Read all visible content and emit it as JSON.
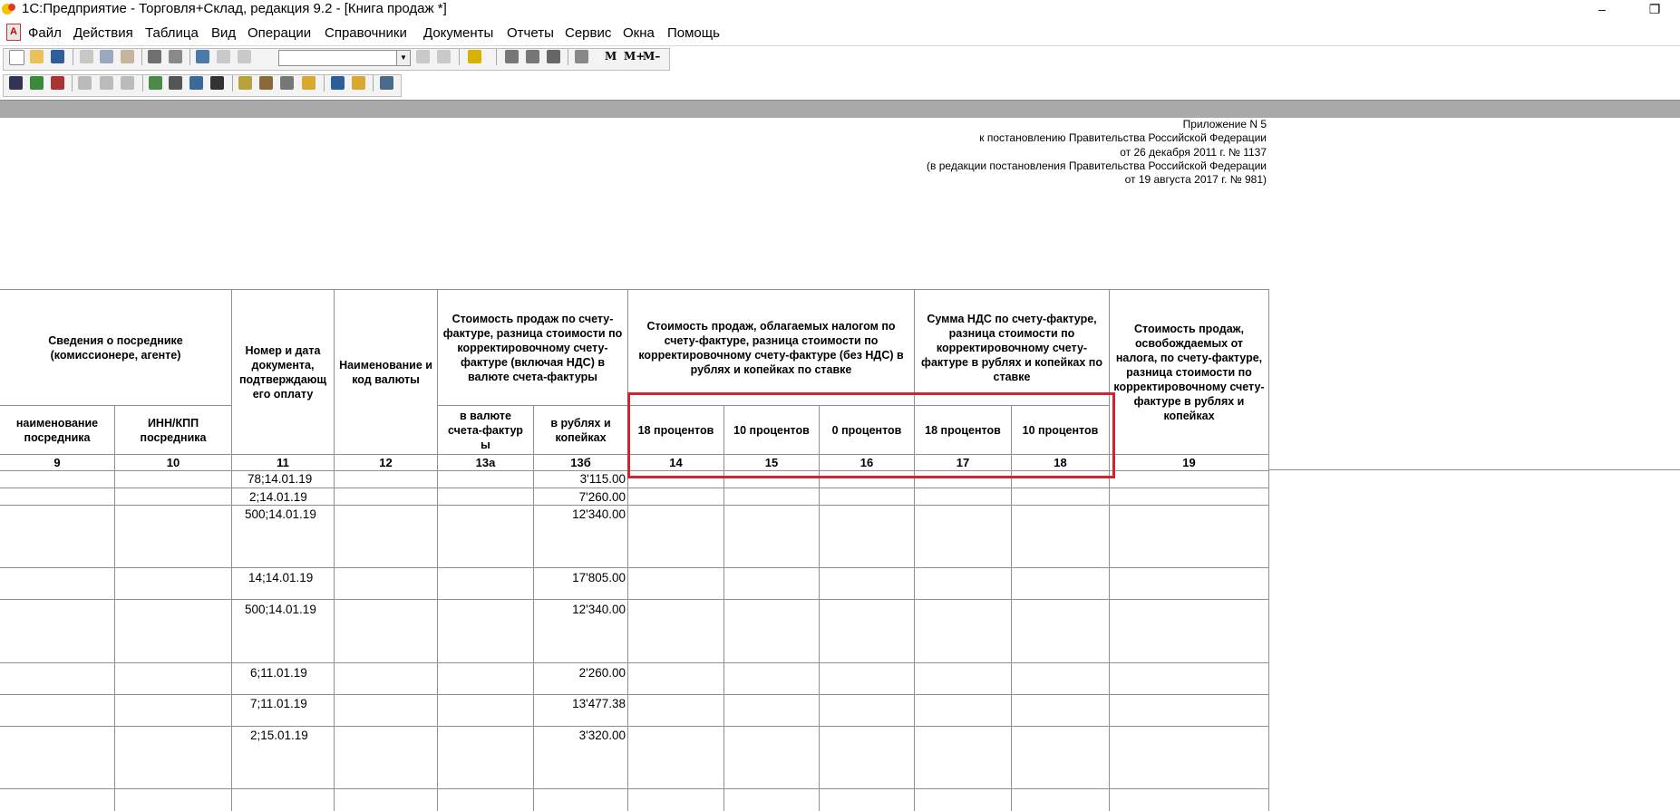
{
  "window": {
    "title": "1С:Предприятие - Торговля+Склад, редакция 9.2 - [Книга продаж  *]",
    "minimize": "–",
    "restore": "❐"
  },
  "menu": {
    "icon": "A",
    "items": [
      "Файл",
      "Действия",
      "Таблица",
      "Вид",
      "Операции",
      "Справочники",
      "Документы",
      "Отчеты",
      "Сервис",
      "Окна",
      "Помощь"
    ]
  },
  "toolbar": {
    "memory_labels": [
      "M",
      "M+",
      "M–"
    ],
    "search_value": ""
  },
  "doc_header": {
    "lines": [
      "Приложение N 5",
      "к постановлению Правительства Российской Федерации",
      "от 26 декабря 2011 г. № 1137",
      "(в редакции постановления Правительства Российской Федерации ",
      "от 19 августа 2017 г. № 981)"
    ]
  },
  "table": {
    "group_headers": {
      "intermediary": "Сведения о посреднике (комиссионере, агенте)",
      "doc_number": "Номер и дата документа, подтверждающ его оплату",
      "currency": "Наименование и код валюты",
      "cost_incl_vat": "Стоимость продаж по счету-фактуре, разница стоимости по корректировочному счету-фактуре (включая НДС) в валюте счета-фактуры",
      "cost_taxed": "Стоимость продаж, облагаемых налогом по счету-фактуре, разница стоимости по корректировочному счету-фактуре (без НДС) в рублях и копейках по ставке",
      "vat_sum": "Сумма НДС по счету-фактуре, разница стоимости по корректировочному счету-фактуре в рублях и копейках по ставке",
      "cost_exempt": "Стоимость продаж, освобождаемых от налога, по счету-фактуре, разница стоимости по корректировочному счету-фактуре в рублях и копейках"
    },
    "sub_headers": {
      "name": "наименование посредника",
      "inn": "ИНН/КПП посредника",
      "in_currency": "в валюте счета-фактур ы",
      "in_rubles": "в рублях и копейках",
      "rate14": "18 процентов",
      "rate15": "10 процентов",
      "rate16": "0 процентов",
      "rate17": "18 процентов",
      "rate18": "10 процентов"
    },
    "column_numbers": [
      "9",
      "10",
      "11",
      "12",
      "13а",
      "13б",
      "14",
      "15",
      "16",
      "17",
      "18",
      "19"
    ],
    "rows": [
      {
        "doc": "78;14.01.19",
        "rub": "3'115.00"
      },
      {
        "doc": "2;14.01.19",
        "rub": "7'260.00"
      },
      {
        "doc": "500;14.01.19",
        "rub": "12'340.00"
      },
      {
        "doc": "14;14.01.19",
        "rub": "17'805.00"
      },
      {
        "doc": "500;14.01.19",
        "rub": "12'340.00"
      },
      {
        "doc": "6;11.01.19",
        "rub": "2'260.00"
      },
      {
        "doc": "7;11.01.19",
        "rub": "13'477.38"
      },
      {
        "doc": "2;15.01.19",
        "rub": "3'320.00"
      }
    ]
  }
}
